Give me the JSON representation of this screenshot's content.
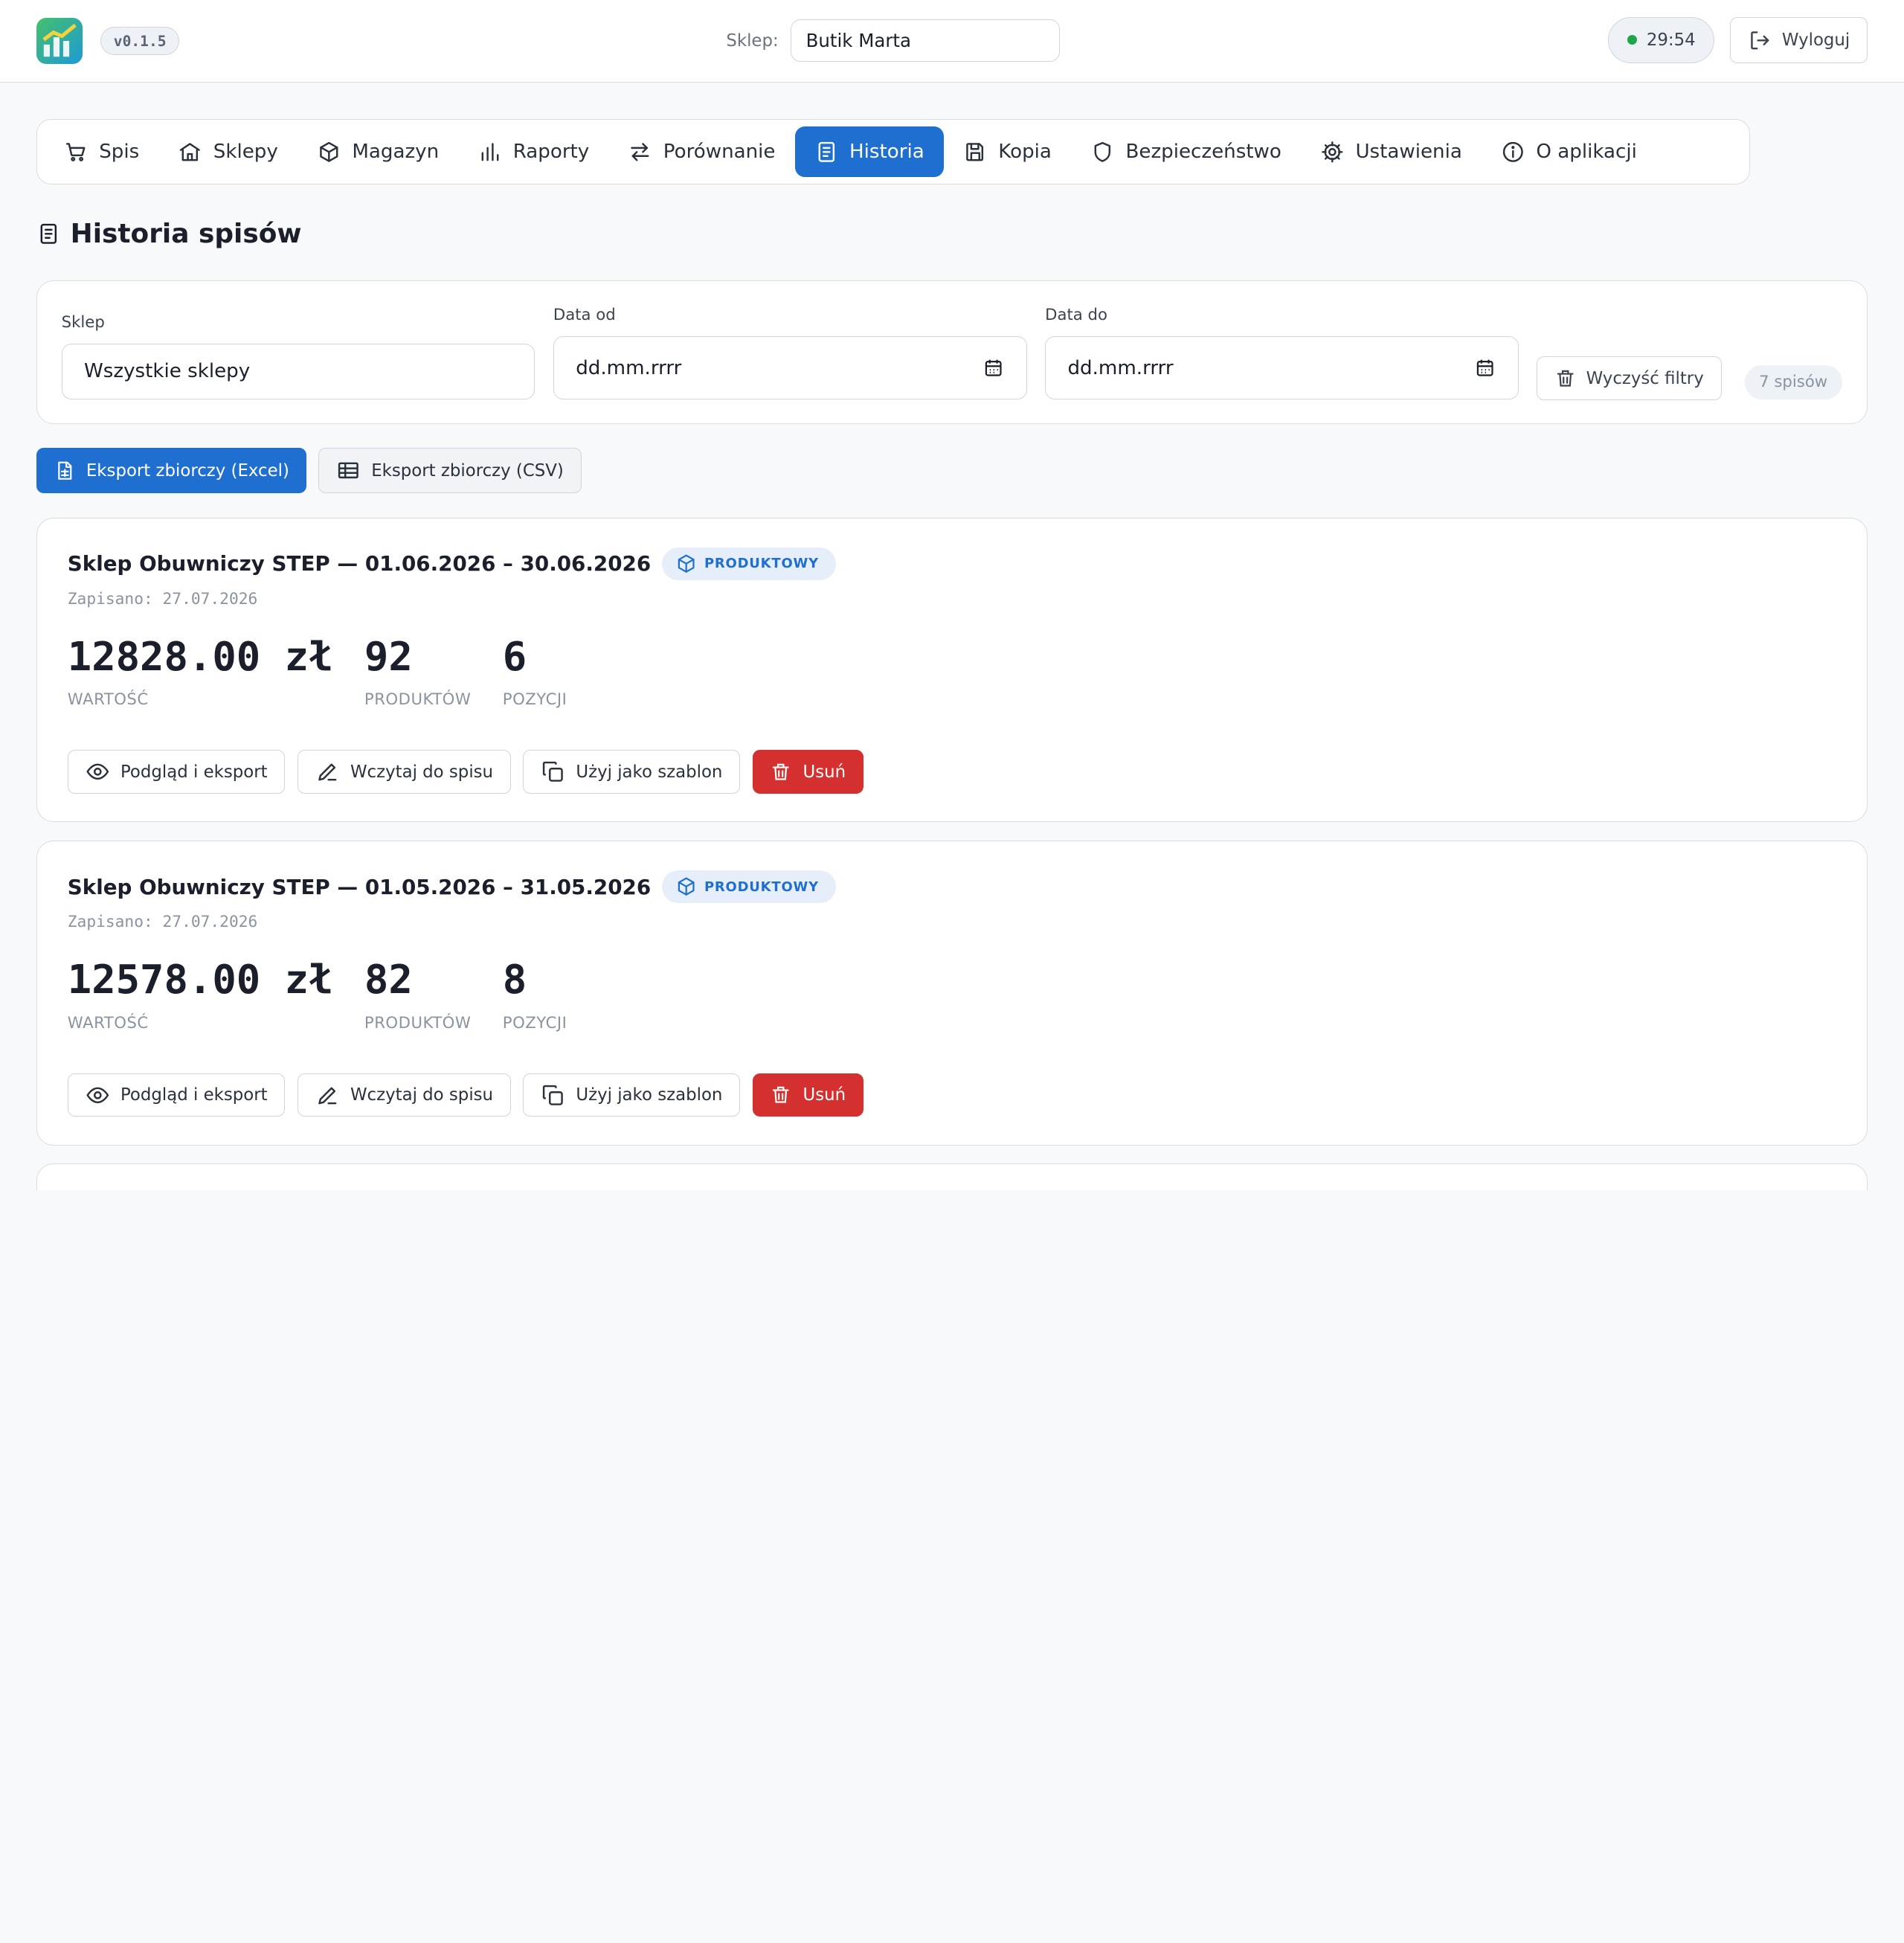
{
  "header": {
    "version": "v0.1.5",
    "shop_label": "Sklep:",
    "shop_value": "Butik Marta",
    "timer": "29:54",
    "logout_label": "Wyloguj"
  },
  "nav": {
    "items": [
      {
        "label": "Spis",
        "icon": "cart-icon"
      },
      {
        "label": "Sklepy",
        "icon": "store-icon"
      },
      {
        "label": "Magazyn",
        "icon": "box-icon"
      },
      {
        "label": "Raporty",
        "icon": "bar-chart-icon"
      },
      {
        "label": "Porównanie",
        "icon": "arrows-swap-icon"
      },
      {
        "label": "Historia",
        "icon": "document-icon"
      },
      {
        "label": "Kopia",
        "icon": "save-icon"
      },
      {
        "label": "Bezpieczeństwo",
        "icon": "shield-icon"
      },
      {
        "label": "Ustawienia",
        "icon": "gear-icon"
      },
      {
        "label": "O aplikacji",
        "icon": "info-icon"
      }
    ],
    "active": "Historia"
  },
  "page": {
    "title": "Historia spisów"
  },
  "filters": {
    "shop_label": "Sklep",
    "shop_value": "Wszystkie sklepy",
    "date_from_label": "Data od",
    "date_from_value": "dd.mm.rrrr",
    "date_to_label": "Data do",
    "date_to_value": "dd.mm.rrrr",
    "clear_label": "Wyczyść filtry",
    "count": "7 spisów"
  },
  "export": {
    "excel_label": "Eksport zbiorczy (Excel)",
    "csv_label": "Eksport zbiorczy (CSV)"
  },
  "cards": [
    {
      "title": "Sklep Obuwniczy STEP — 01.06.2026 – 30.06.2026",
      "type": "PRODUKTOWY",
      "saved": "Zapisano: 27.07.2026",
      "value": "12828.00 zł",
      "value_label": "WARTOŚĆ",
      "products": "92",
      "products_label": "PRODUKTÓW",
      "positions": "6",
      "positions_label": "POZYCJI",
      "actions": {
        "preview": "Podgląd i eksport",
        "load": "Wczytaj do spisu",
        "template": "Użyj jako szablon",
        "delete": "Usuń"
      }
    },
    {
      "title": "Sklep Obuwniczy STEP — 01.05.2026 – 31.05.2026",
      "type": "PRODUKTOWY",
      "saved": "Zapisano: 27.07.2026",
      "value": "12578.00 zł",
      "value_label": "WARTOŚĆ",
      "products": "82",
      "products_label": "PRODUKTÓW",
      "positions": "8",
      "positions_label": "POZYCJI",
      "actions": {
        "preview": "Podgląd i eksport",
        "load": "Wczytaj do spisu",
        "template": "Użyj jako szablon",
        "delete": "Usuń"
      }
    }
  ],
  "colors": {
    "accent": "#1e6fd0",
    "danger": "#d3302f",
    "status": "#1fa64a"
  }
}
